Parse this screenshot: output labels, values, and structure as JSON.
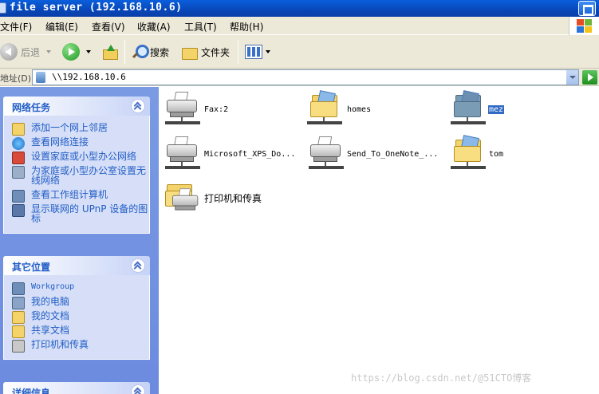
{
  "window": {
    "title": "file server (192.168.10.6)"
  },
  "menu": {
    "items": [
      "文件(F)",
      "编辑(E)",
      "查看(V)",
      "收藏(A)",
      "工具(T)",
      "帮助(H)"
    ]
  },
  "toolbar": {
    "back_label": "后退",
    "search_label": "搜索",
    "folders_label": "文件夹"
  },
  "address": {
    "label": "地址(D)",
    "value": "\\\\192.168.10.6"
  },
  "tasks": {
    "network": {
      "title": "网络任务",
      "links": [
        "添加一个网上邻居",
        "查看网络连接",
        "设置家庭或小型办公网络",
        "为家庭或小型办公室设置无线网络",
        "查看工作组计算机",
        "显示联网的 UPnP 设备的图标"
      ]
    },
    "other": {
      "title": "其它位置",
      "links": [
        "Workgroup",
        "我的电脑",
        "我的文档",
        "共享文档",
        "打印机和传真"
      ]
    },
    "details": {
      "title": "详细信息"
    }
  },
  "items": [
    {
      "label": "Fax:2",
      "icon": "printer-icon"
    },
    {
      "label": "homes",
      "icon": "shared-folder-icon"
    },
    {
      "label": "mez",
      "icon": "shared-folder-icon"
    },
    {
      "label": "Microsoft_XPS_Do...",
      "icon": "printer-icon"
    },
    {
      "label": "Send_To_OneNote_...",
      "icon": "printer-icon"
    },
    {
      "label": "tom",
      "icon": "shared-folder-icon"
    },
    {
      "label": "打印机和传真",
      "icon": "printers-faxes-icon"
    }
  ],
  "watermark": "https://blog.csdn.net/@51CTO博客"
}
